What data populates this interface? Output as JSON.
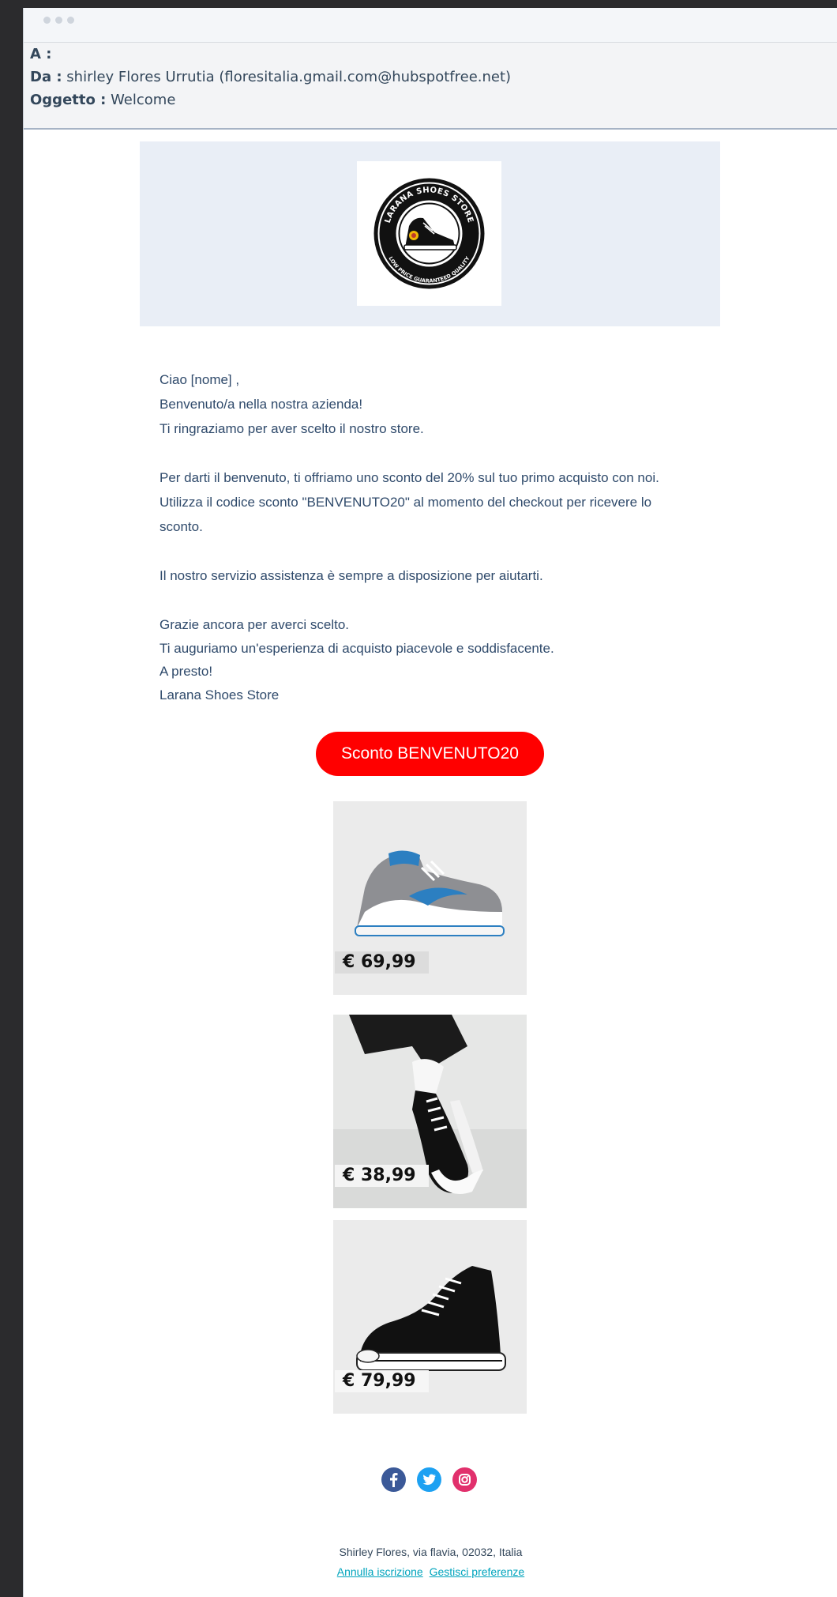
{
  "email": {
    "to_label": "A :",
    "from_label": "Da :",
    "from_value": "shirley Flores Urrutia (floresitalia.gmail.com@hubspotfree.net)",
    "subject_label": "Oggetto :",
    "subject_value": "Welcome"
  },
  "logo": {
    "top_text": "LARANA SHOES STORE",
    "bottom_text": "LOW PRICE GUARANTEED QUALITY"
  },
  "body": {
    "greeting": "Ciao [nome] ,",
    "line1": "Benvenuto/a nella nostra azienda!",
    "line2": "Ti ringraziamo per aver scelto il nostro store.",
    "para2": "Per darti il benvenuto, ti offriamo uno sconto del 20% sul tuo primo acquisto con noi.\nUtilizza il codice sconto \"BENVENUTO20\" al momento del checkout per ricevere lo\nsconto.",
    "para3": "Il nostro servizio assistenza è sempre a disposizione per aiutarti.",
    "para4_1": "Grazie ancora per averci scelto.",
    "para4_2": "Ti auguriamo un'esperienza di acquisto piacevole e soddisfacente.",
    "para4_3": "A presto!",
    "signature": "Larana Shoes Store"
  },
  "cta": {
    "label": "Sconto BENVENUTO20"
  },
  "products": [
    {
      "price": "€ 69,99",
      "colors": {
        "accent": "#2c7fc1",
        "upper": "#8e8f93"
      }
    },
    {
      "price": "€ 38,99",
      "colors": {
        "accent": "#111111",
        "upper": "#111111"
      }
    },
    {
      "price": "€ 79,99",
      "colors": {
        "accent": "#111111",
        "upper": "#111111"
      }
    }
  ],
  "social": [
    {
      "icon": "facebook-icon",
      "color": "#3b5998"
    },
    {
      "icon": "twitter-icon",
      "color": "#1da1f2"
    },
    {
      "icon": "instagram-icon",
      "color": "#e1306c"
    }
  ],
  "footer": {
    "address": "Shirley Flores, via flavia, 02032, Italia",
    "unsubscribe": "Annulla iscrizione",
    "preferences": "Gestisci preferenze"
  }
}
